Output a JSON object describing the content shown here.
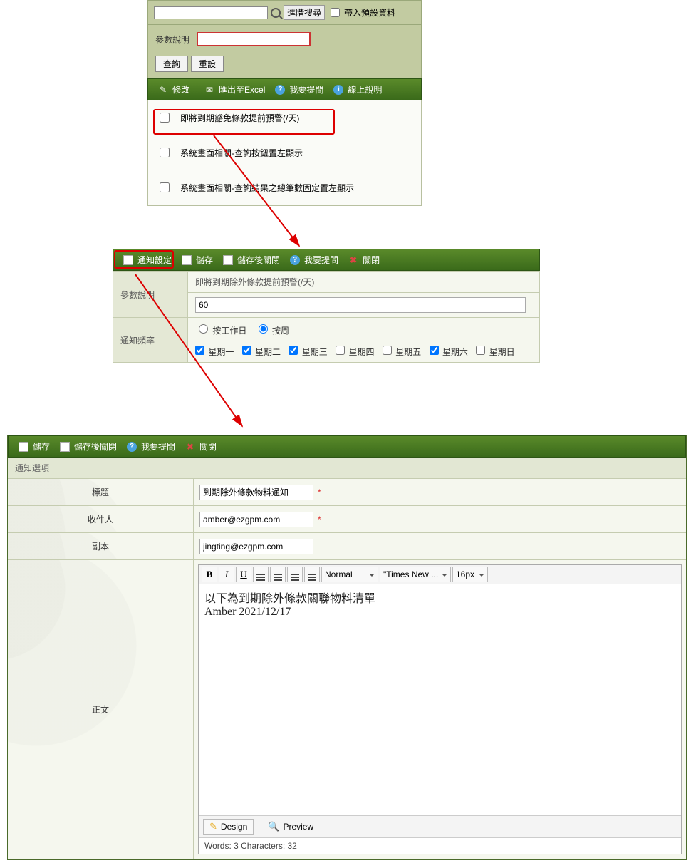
{
  "panel1": {
    "search": {
      "placeholder": "",
      "advanced": "進階搜尋",
      "load_default": "帶入預設資料"
    },
    "param_label": "參數說明",
    "param_value": "",
    "query_btn": "查詢",
    "reset_btn": "重設",
    "toolbar": {
      "edit": "修改",
      "export": "匯出至Excel",
      "ask": "我要提問",
      "help": "線上說明"
    },
    "rows": [
      "即將到期豁免條款提前預警(/天)",
      "系統畫面相關-查詢按鈕置左顯示",
      "系統畫面相關-查詢結果之總筆數固定置左顯示"
    ]
  },
  "panel2": {
    "toolbar": {
      "notify": "通知設定",
      "save": "儲存",
      "save_close": "儲存後關閉",
      "ask": "我要提問",
      "close": "關閉"
    },
    "param_label": "參數說明",
    "param_value_text": "即將到期除外條款提前預警(/天)",
    "days_value": "60",
    "freq_label": "通知頻率",
    "radio_workday": "按工作日",
    "radio_weekly": "按周",
    "days": {
      "mon": "星期一",
      "tue": "星期二",
      "wed": "星期三",
      "thu": "星期四",
      "fri": "星期五",
      "sat": "星期六",
      "sun": "星期日"
    }
  },
  "panel3": {
    "toolbar": {
      "save": "儲存",
      "save_close": "儲存後關閉",
      "ask": "我要提問",
      "close": "關閉"
    },
    "section": "通知選項",
    "title_label": "標題",
    "title_value": "到期除外條款物料通知",
    "recipient_label": "收件人",
    "recipient_value": "amber@ezgpm.com",
    "cc_label": "副本",
    "cc_value": "jingting@ezgpm.com",
    "body_label": "正文",
    "editor": {
      "style_sel": "Normal",
      "font_sel": "\"Times New ...",
      "size_sel": "16px",
      "body_line1": "以下為到期除外條款關聯物料清單",
      "body_line2": "Amber 2021/12/17",
      "design_tab": "Design",
      "preview_tab": "Preview",
      "status": "Words: 3   Characters: 32"
    }
  }
}
